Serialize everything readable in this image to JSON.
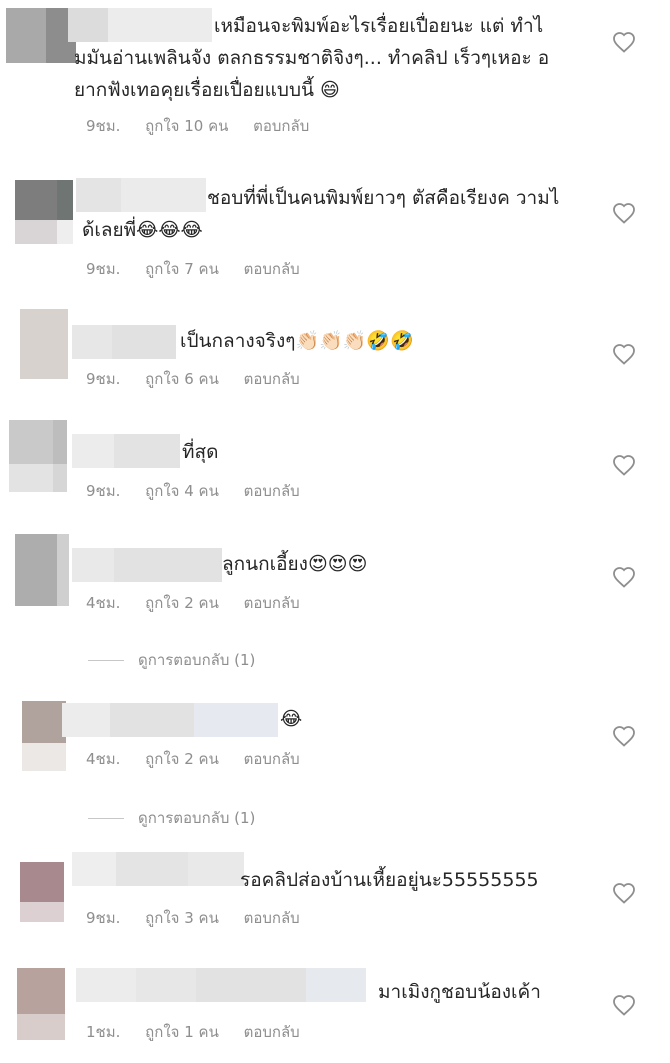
{
  "comments": [
    {
      "text": "เหมือนจะพิมพ์อะไรเรื่อยเปื่อยนะ แต่ ทำไมมันอ่านเพลินจัง ตลกธรรมชาติจิงๆ... ทำคลิป เร็วๆเหอะ อยากฟังเทอคุยเรื่อยเปื่อยแบบนี้ 😄",
      "time": "9ชม.",
      "likes": "ถูกใจ 10 คน",
      "reply": "ตอบกลับ"
    },
    {
      "text": "ชอบที่พี่เป็นคนพิมพ์ยาวๆ ตัสคือเรียงค วามได้เลยพี่😂😂😂",
      "time": "9ชม.",
      "likes": "ถูกใจ 7 คน",
      "reply": "ตอบกลับ"
    },
    {
      "text": "เป็นกลางจริงๆ👏🏻👏🏻👏🏻🤣🤣",
      "time": "9ชม.",
      "likes": "ถูกใจ 6 คน",
      "reply": "ตอบกลับ"
    },
    {
      "text": "ที่สุด",
      "time": "9ชม.",
      "likes": "ถูกใจ 4 คน",
      "reply": "ตอบกลับ"
    },
    {
      "text": "ลูกนกเอี้ยง😍😍😍",
      "time": "4ชม.",
      "likes": "ถูกใจ 2 คน",
      "reply": "ตอบกลับ"
    },
    {
      "text": "😂",
      "time": "4ชม.",
      "likes": "ถูกใจ 2 คน",
      "reply": "ตอบกลับ"
    },
    {
      "text": "รอคลิปส่องบ้านเหี้ยอยู่นะ55555555",
      "time": "9ชม.",
      "likes": "ถูกใจ 3 คน",
      "reply": "ตอบกลับ"
    },
    {
      "text": "มาเมิงกูชอบน้องเค้า",
      "time": "1ชม.",
      "likes": "ถูกใจ 1 คน",
      "reply": "ตอบกลับ"
    }
  ],
  "view_replies": [
    "ดูการตอบกลับ (1)",
    "ดูการตอบกลับ (1)"
  ],
  "colors": {
    "text": "#262626",
    "meta": "#8e8e8e",
    "heart_outline": "#8e8e8e"
  },
  "icons": {
    "like": "heart-outline-icon"
  }
}
